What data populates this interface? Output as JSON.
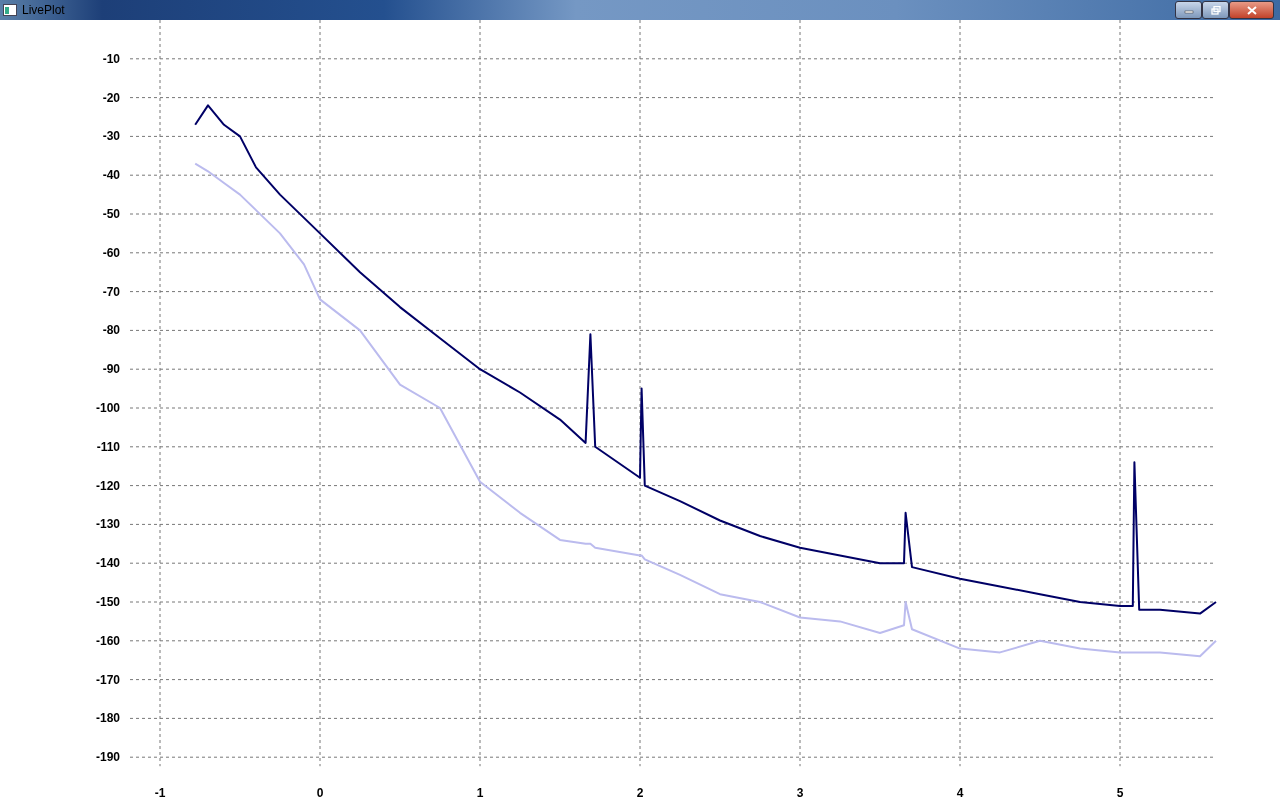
{
  "window": {
    "title": "LivePlot"
  },
  "chart_data": {
    "type": "line",
    "x": [
      -0.78,
      -0.7,
      -0.6,
      -0.5,
      -0.4,
      -0.25,
      -0.1,
      0,
      0.25,
      0.5,
      0.75,
      1,
      1.25,
      1.5,
      1.66,
      1.69,
      1.72,
      2,
      2.01,
      2.03,
      2.25,
      2.5,
      2.75,
      3,
      3.25,
      3.5,
      3.65,
      3.66,
      3.7,
      4,
      4.25,
      4.5,
      4.75,
      5,
      5.08,
      5.09,
      5.12,
      5.25,
      5.5,
      5.6
    ],
    "series": [
      {
        "color": "#000066",
        "values": [
          -27,
          -22,
          -27,
          -30,
          -38,
          -45,
          -51,
          -55,
          -65,
          -74,
          -82,
          -90,
          -96,
          -103,
          -109,
          -81,
          -110,
          -118,
          -95,
          -120,
          -124,
          -129,
          -133,
          -136,
          -138,
          -140,
          -140,
          -127,
          -141,
          -144,
          -146,
          -148,
          -150,
          -151,
          -151,
          -114,
          -152,
          -152,
          -153,
          -150
        ]
      },
      {
        "color": "#bbbbee",
        "values": [
          -37,
          -39,
          -42,
          -45,
          -49,
          -55,
          -63,
          -72,
          -80,
          -94,
          -100,
          -119,
          -127,
          -134,
          -135,
          -135,
          -136,
          -138,
          -138,
          -139,
          -143,
          -148,
          -150,
          -154,
          -155,
          -158,
          -156,
          -150,
          -157,
          -162,
          -163,
          -160,
          -162,
          -163,
          -163,
          -163,
          -163,
          -163,
          -164,
          -160
        ]
      }
    ],
    "xlim": [
      -1,
      5.6
    ],
    "ylim": [
      -190,
      0
    ],
    "grid": true,
    "xticks": [
      -1,
      0,
      1,
      2,
      3,
      4,
      5
    ],
    "yticks": [
      -10,
      -20,
      -30,
      -40,
      -50,
      -60,
      -70,
      -80,
      -90,
      -100,
      -110,
      -120,
      -130,
      -140,
      -150,
      -160,
      -170,
      -180,
      -190
    ]
  }
}
